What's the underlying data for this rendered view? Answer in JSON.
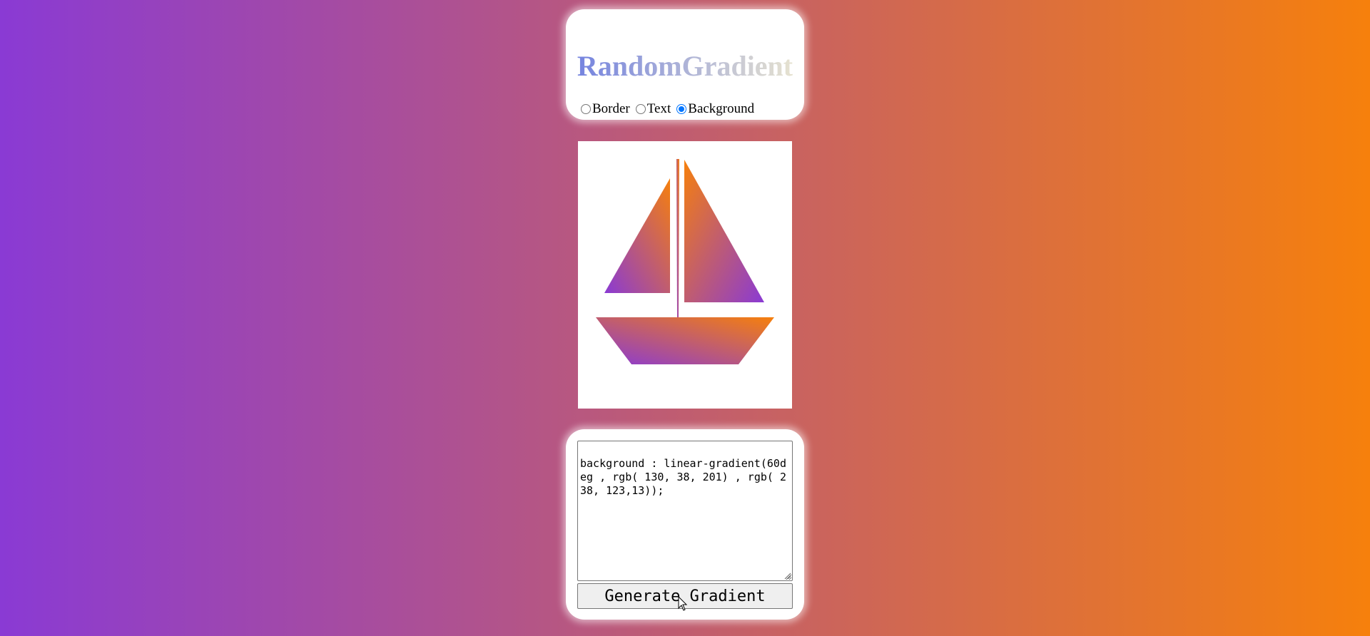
{
  "colors": {
    "gradient_start": "#8a3ad4",
    "gradient_end": "#f6800c",
    "title_gradient_start": "#6f7fe0",
    "title_gradient_end": "#ece7cf",
    "radio_accent": "#0075ff"
  },
  "header": {
    "title": "RandomGradient",
    "mode_options": [
      {
        "label": "Border",
        "checked": false
      },
      {
        "label": "Text",
        "checked": false
      },
      {
        "label": "Background",
        "checked": true
      }
    ]
  },
  "preview": {
    "icon": "sailboat-icon"
  },
  "output": {
    "css_text": "background : linear-gradient(60deg , rgb( 130, 38, 201) , rgb( 238, 123,13));"
  },
  "actions": {
    "generate_label": "Generate Gradient"
  }
}
